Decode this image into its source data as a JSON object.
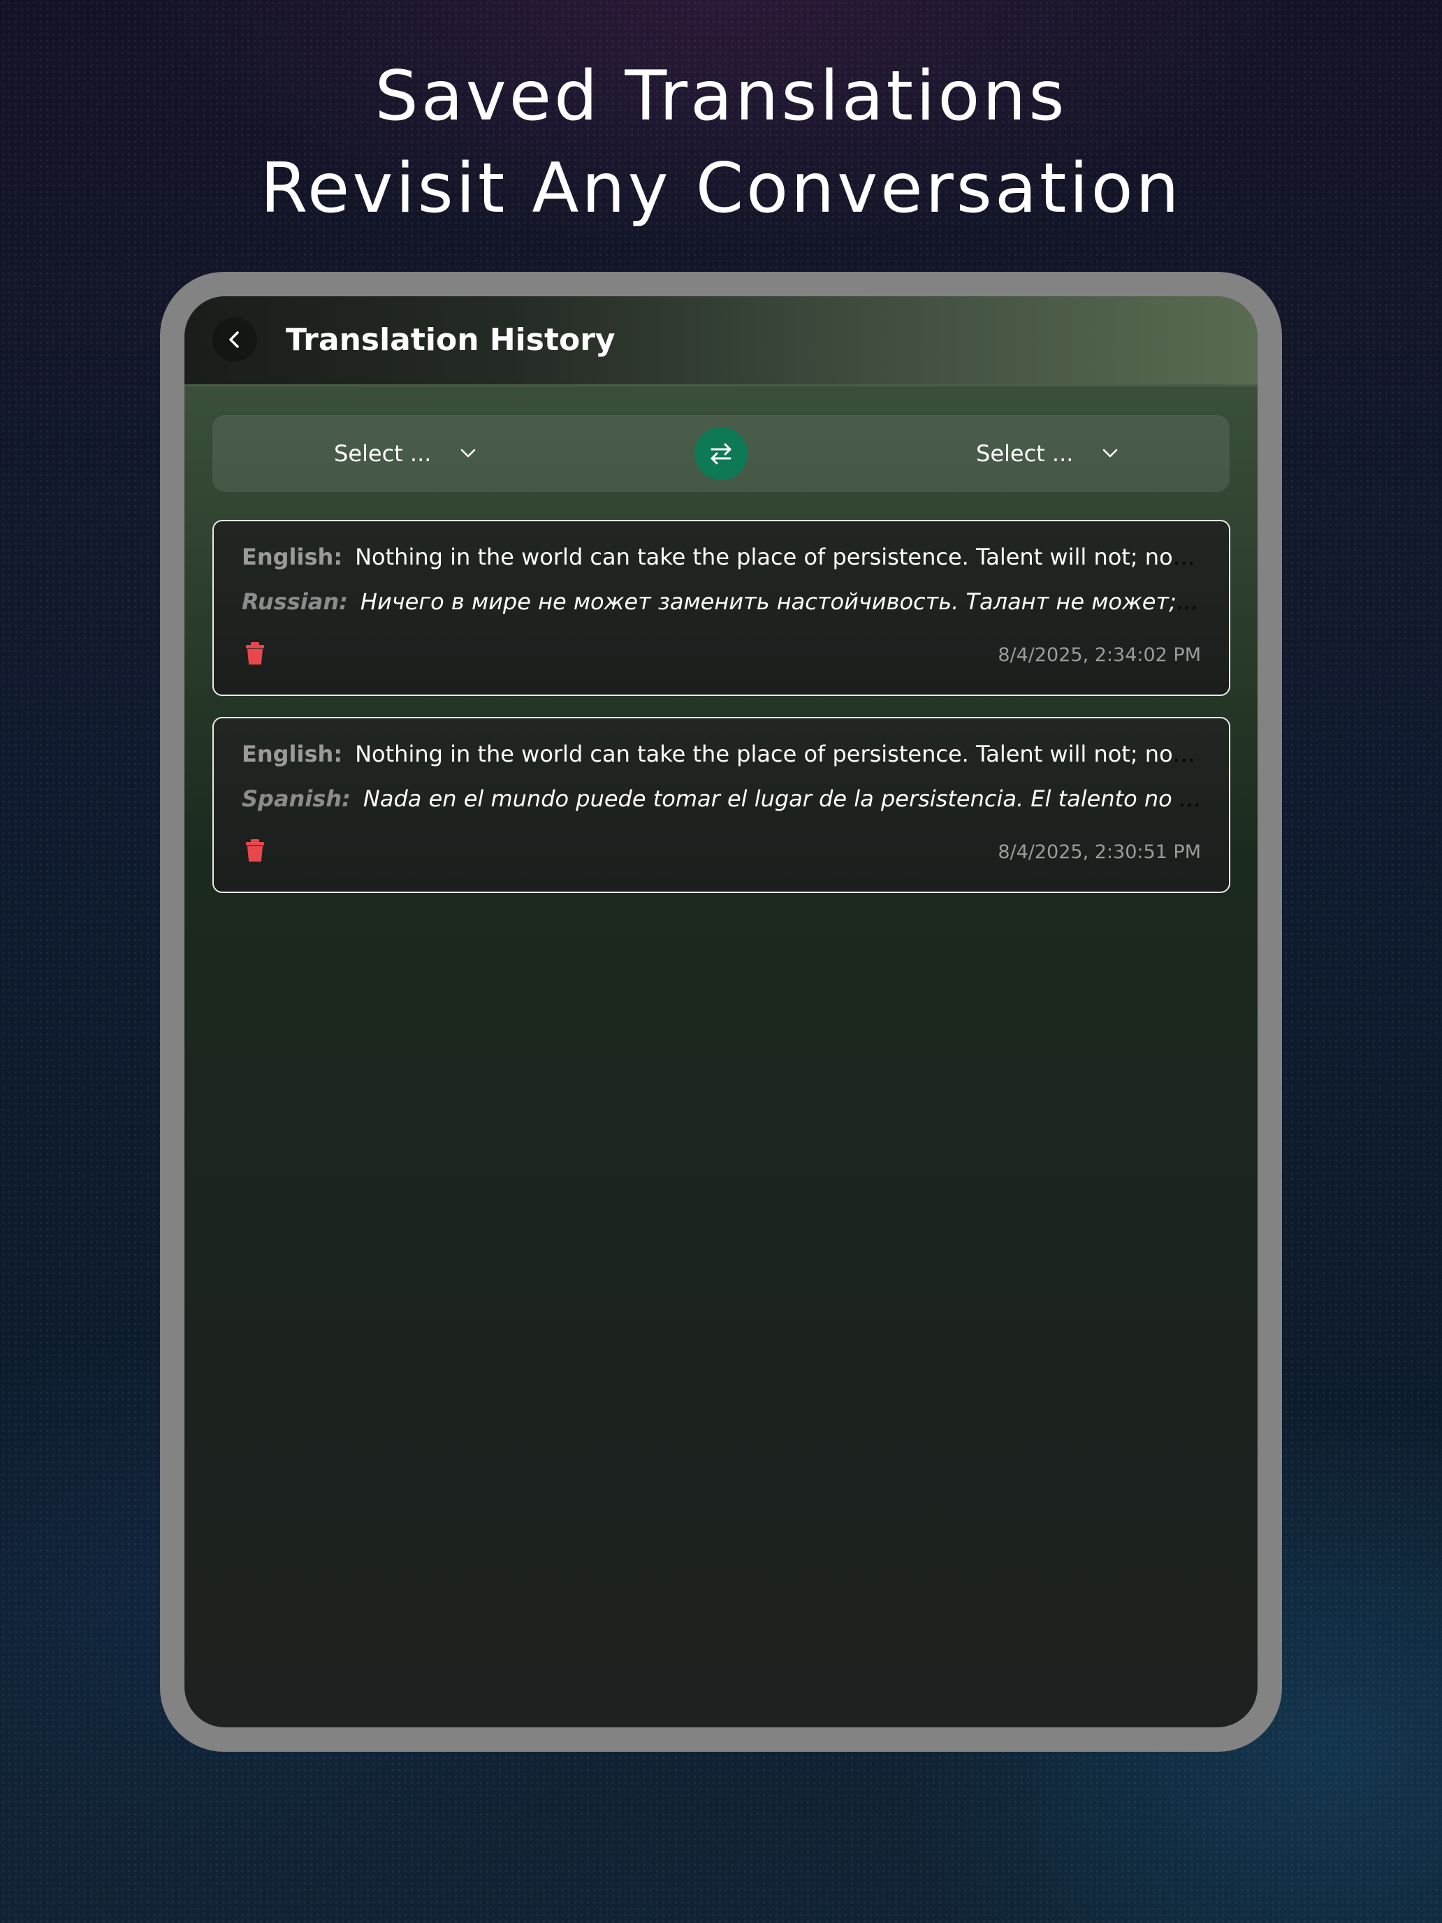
{
  "headline": {
    "line1": "Saved Translations",
    "line2": "Revisit Any Conversation"
  },
  "appbar": {
    "title": "Translation History",
    "back_icon": "chevron-left-icon"
  },
  "language_bar": {
    "source_select": "Select ...",
    "target_select": "Select ...",
    "swap_icon": "swap-arrows-icon",
    "accent_color": "#0e7a55"
  },
  "history": [
    {
      "source_label": "English:",
      "source_text": "Nothing in the world can take the place of persistence. Talent will not; nothing is more common than unsuccessful men with talent.",
      "target_label": "Russian:",
      "target_text": "Ничего в мире не может заменить настойчивость. Талант не может; ничего нет более распространенного, чем неудачники с талантом.",
      "timestamp": "8/4/2025, 2:34:02 PM"
    },
    {
      "source_label": "English:",
      "source_text": "Nothing in the world can take the place of persistence. Talent will not; nothing is more common than unsuccessful men with talent.",
      "target_label": "Spanish:",
      "target_text": "Nada en el mundo puede tomar el lugar de la persistencia. El talento no lo hará; nada es más común que hombres sin éxito con talento.",
      "timestamp": "8/4/2025, 2:30:51 PM"
    }
  ],
  "colors": {
    "delete_icon": "#e8474b",
    "card_border": "#e9ece9"
  }
}
